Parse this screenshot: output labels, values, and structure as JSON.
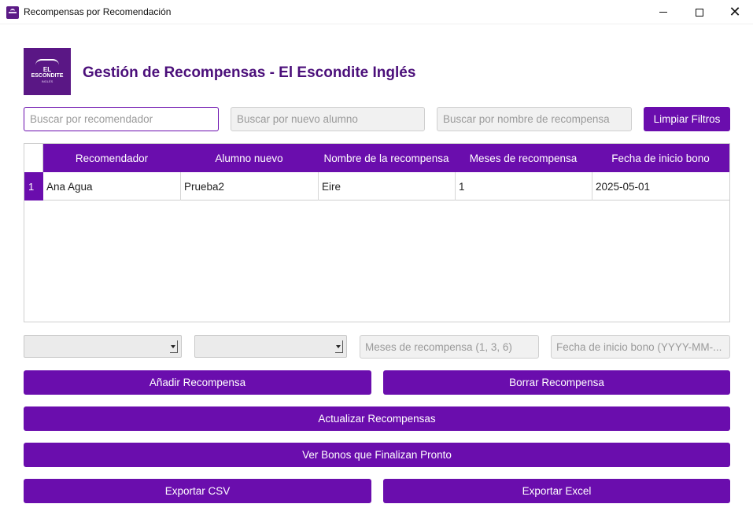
{
  "window": {
    "title": "Recompensas por Recomendación",
    "minimize_label": "",
    "maximize_label": "",
    "close_label": "✕"
  },
  "header": {
    "logo": {
      "line1": "EL",
      "line2": "ESCONDITE",
      "line3": "INGLÉS"
    },
    "title": "Gestión de Recompensas - El Escondite Inglés"
  },
  "filters": {
    "recomendador_placeholder": "Buscar por recomendador",
    "alumno_placeholder": "Buscar por nuevo alumno",
    "recompensa_placeholder": "Buscar por nombre de recompensa",
    "clear_label": "Limpiar Filtros"
  },
  "table": {
    "columns": [
      "Recomendador",
      "Alumno nuevo",
      "Nombre de la recompensa",
      "Meses de recompensa",
      "Fecha de inicio bono"
    ],
    "rows": [
      {
        "index": "1",
        "cells": [
          "Ana Agua",
          "Prueba2",
          "Eire",
          "1",
          "2025-05-01"
        ]
      }
    ]
  },
  "form": {
    "combo1_value": "",
    "combo2_value": "",
    "meses_placeholder": "Meses de recompensa (1, 3, 6)",
    "fecha_placeholder": "Fecha de inicio bono (YYYY-MM-..."
  },
  "actions": {
    "add": "Añadir Recompensa",
    "delete": "Borrar Recompensa",
    "update": "Actualizar Recompensas",
    "expiring": "Ver Bonos que Finalizan Pronto",
    "export_csv": "Exportar CSV",
    "export_excel": "Exportar Excel"
  },
  "colors": {
    "accent": "#6a0dad",
    "title": "#4b0f7a",
    "logo_bg": "#5a1785"
  }
}
